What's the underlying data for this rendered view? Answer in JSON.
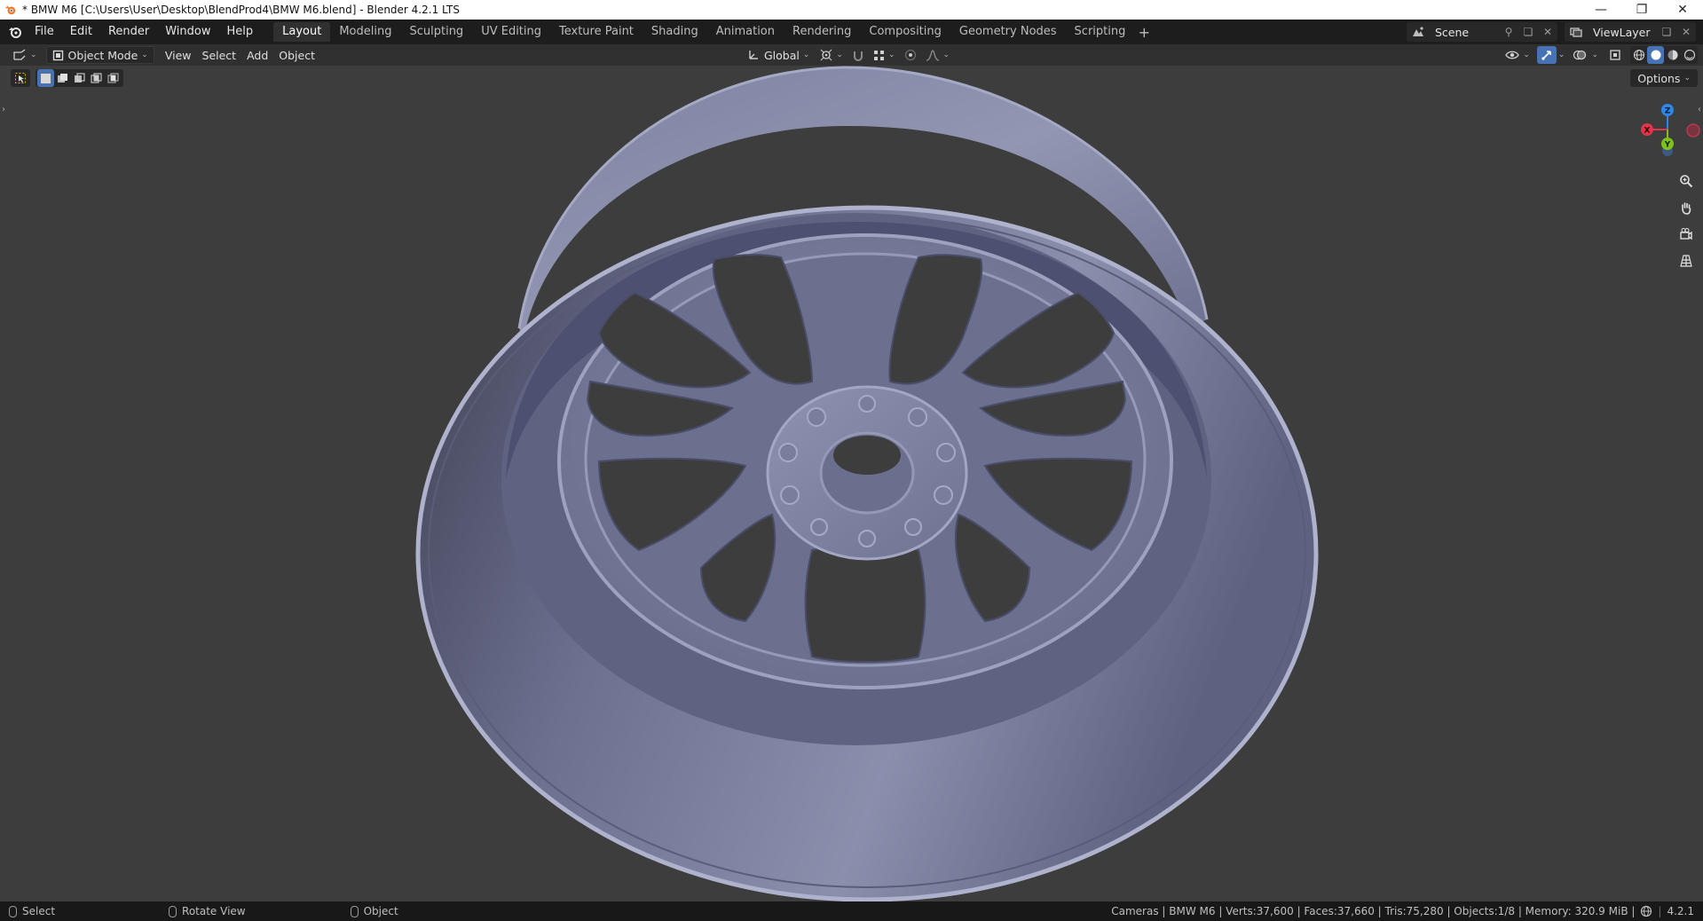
{
  "window": {
    "title": "* BMW M6 [C:\\Users\\User\\Desktop\\BlendProd4\\BMW M6.blend] - Blender 4.2.1 LTS",
    "minimize": "—",
    "restore": "❐",
    "close": "✕"
  },
  "menu": {
    "items": [
      "File",
      "Edit",
      "Render",
      "Window",
      "Help"
    ]
  },
  "workspaces": {
    "tabs": [
      "Layout",
      "Modeling",
      "Sculpting",
      "UV Editing",
      "Texture Paint",
      "Shading",
      "Animation",
      "Rendering",
      "Compositing",
      "Geometry Nodes",
      "Scripting"
    ],
    "active": "Layout",
    "add": "+"
  },
  "scene": {
    "name": "Scene"
  },
  "view_layer": {
    "name": "ViewLayer"
  },
  "header": {
    "mode": "Object Mode",
    "view": "View",
    "select": "Select",
    "add": "Add",
    "object": "Object",
    "transform_orientation": "Global"
  },
  "viewport": {
    "options": "Options",
    "gizmo": {
      "z": "Z",
      "y": "Y",
      "x": "X"
    },
    "accent": "#4772b3",
    "axis_colors": {
      "x": "#e2344a",
      "y": "#7fbf1f",
      "z": "#2e86e8"
    }
  },
  "statusbar": {
    "select": "Select",
    "rotate": "Rotate View",
    "object": "Object",
    "stats": "Cameras | BMW M6 | Verts:37,600 | Faces:37,660 | Tris:75,280 | Objects:1/8 | Memory: 320.9 MiB |",
    "version": "4.2.1"
  }
}
